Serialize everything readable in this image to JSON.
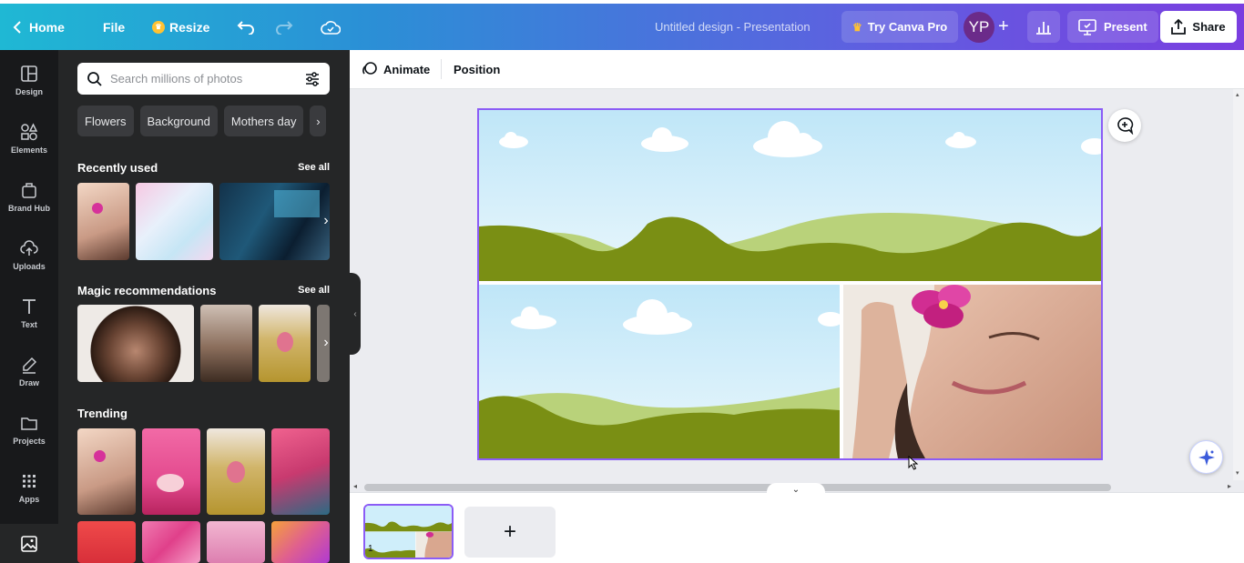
{
  "topbar": {
    "home_label": "Home",
    "file_label": "File",
    "resize_label": "Resize",
    "title": "Untitled design - Presentation",
    "pro_label": "Try Canva Pro",
    "avatar_initials": "YP",
    "present_label": "Present",
    "share_label": "Share"
  },
  "rail": {
    "items": [
      {
        "label": "Design",
        "icon": "layout-icon"
      },
      {
        "label": "Elements",
        "icon": "shapes-icon"
      },
      {
        "label": "Brand Hub",
        "icon": "brand-icon"
      },
      {
        "label": "Uploads",
        "icon": "upload-icon"
      },
      {
        "label": "Text",
        "icon": "text-icon"
      },
      {
        "label": "Draw",
        "icon": "pen-icon"
      },
      {
        "label": "Projects",
        "icon": "folder-icon"
      },
      {
        "label": "Apps",
        "icon": "apps-icon"
      }
    ]
  },
  "panel": {
    "search_placeholder": "Search millions of photos",
    "chips": [
      "Flowers",
      "Background",
      "Mothers day"
    ],
    "recent_title": "Recently used",
    "magic_title": "Magic recommendations",
    "trending_title": "Trending",
    "see_all": "See all"
  },
  "toolbar": {
    "animate_label": "Animate",
    "position_label": "Position"
  },
  "pages": {
    "current_page": "1"
  },
  "colors": {
    "accent": "#8b5cf6",
    "sky": "#cfeefa",
    "hill_dark": "#7a8f14",
    "hill_light": "#b9d27a"
  }
}
